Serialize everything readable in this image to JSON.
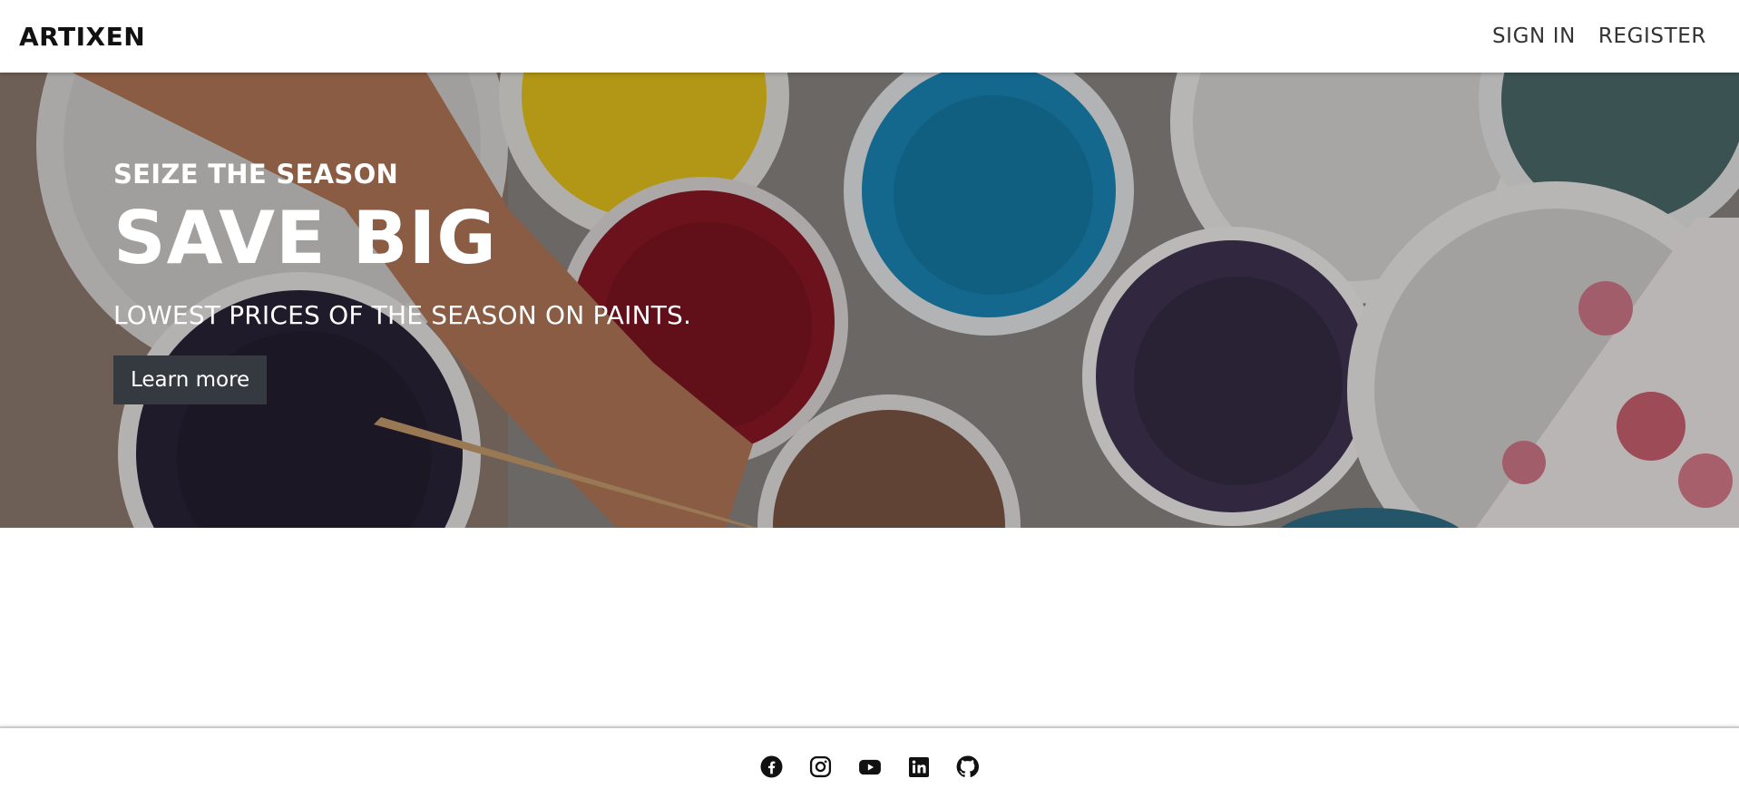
{
  "header": {
    "brand": "ARTIXEN",
    "nav": [
      {
        "label": "SIGN IN"
      },
      {
        "label": "REGISTER"
      }
    ]
  },
  "hero": {
    "eyebrow": "SEIZE THE SEASON",
    "headline": "SAVE BIG",
    "subline": "LOWEST PRICES OF THE SEASON ON PAINTS.",
    "cta_label": "Learn more",
    "background_image": "paint-buckets-photo",
    "cta_color": "#343a40"
  },
  "footer": {
    "social_icons": [
      "facebook-icon",
      "instagram-icon",
      "youtube-icon",
      "linkedin-icon",
      "github-icon"
    ]
  }
}
